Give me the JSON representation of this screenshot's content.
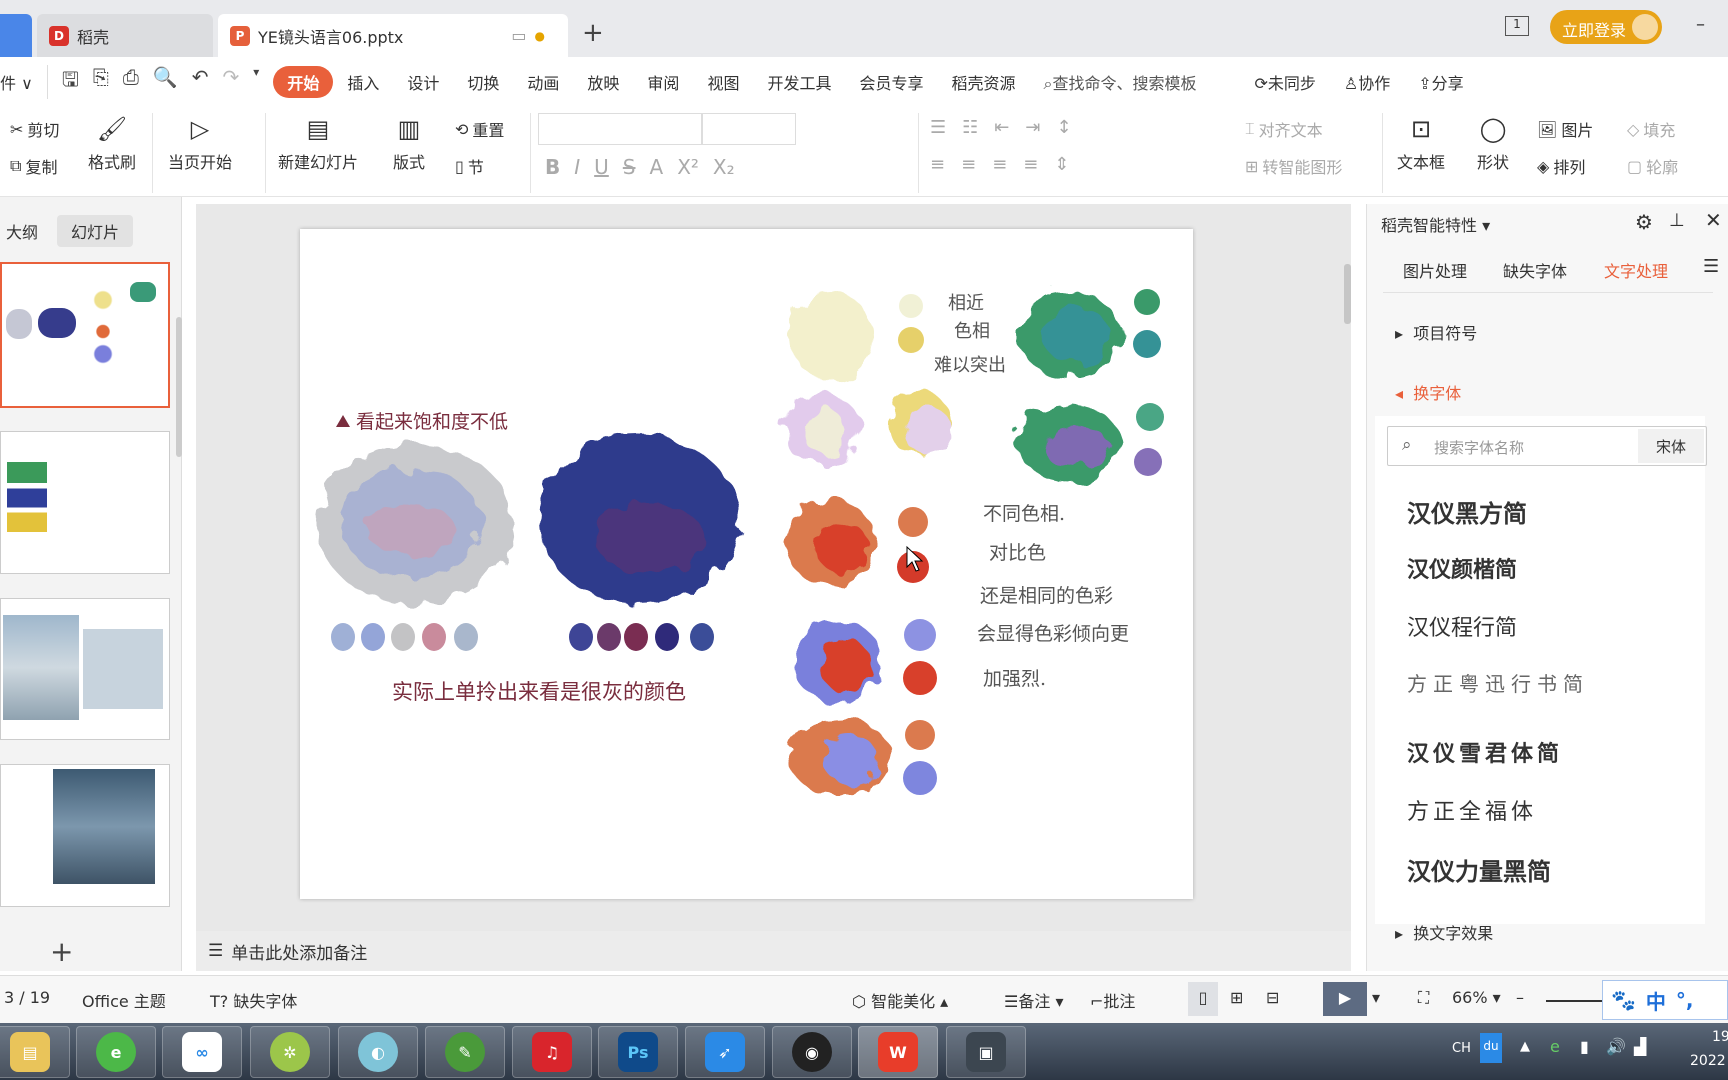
{
  "tabs": {
    "home_tab": "稻壳",
    "doc_tab": "YE镜头语言06.pptx",
    "new_tab": "+",
    "login": "立即登录",
    "page_counter": "1"
  },
  "menu": {
    "file": "件",
    "items": [
      "开始",
      "插入",
      "设计",
      "切换",
      "动画",
      "放映",
      "审阅",
      "视图",
      "开发工具",
      "会员专享",
      "稻壳资源"
    ],
    "search": "查找命令、搜索模板",
    "sync": "未同步",
    "collab": "协作",
    "share": "分享"
  },
  "ribbon": {
    "cut": "剪切",
    "copy": "复制",
    "format_painter": "格式刷",
    "play_from_current": "当页开始",
    "new_slide": "新建幻灯片",
    "layout": "版式",
    "reset": "重置",
    "section": "节",
    "align_text": "对齐文本",
    "smart_graphic": "转智能图形",
    "textbox": "文本框",
    "shape": "形状",
    "picture": "图片",
    "arrange": "排列",
    "fill": "填充",
    "outline": "轮廓"
  },
  "left_pane": {
    "outline_tab": "大纲",
    "slides_tab": "幻灯片",
    "add": "+"
  },
  "slide": {
    "text_saturation": "看起来饱和度不低",
    "text_gray": "实际上单拎出来看是很灰的颜色",
    "text_similar": [
      "相近",
      "色相",
      "难以突出"
    ],
    "text_contrast": [
      "不同色相.",
      "对比色",
      "还是相同的色彩",
      "会显得色彩倾向更",
      "加强烈."
    ],
    "left_swatches": [
      "#9fb0d6",
      "#94a5d8",
      "#c3c3c5",
      "#c98b9c",
      "#a9b7cc"
    ],
    "right_swatches": [
      "#3e4596",
      "#6b3a6a",
      "#7a2d52",
      "#2f2a7a",
      "#3b4d98"
    ]
  },
  "notes": {
    "placeholder": "单击此处添加备注"
  },
  "right_panel": {
    "title": "稻壳智能特性",
    "tabs": [
      "图片处理",
      "缺失字体",
      "文字处理"
    ],
    "sections": {
      "bullets": "项目符号",
      "change_font": "换字体",
      "text_effects": "换文字效果"
    },
    "search_placeholder": "搜索字体名称",
    "current_font": "宋体",
    "fonts": [
      "汉仪黑方简",
      "汉仪颜楷简",
      "汉仪程行简",
      "方正粤迅行书简",
      "汉仪雪君体简",
      "方正全福体",
      "汉仪力量黑简"
    ]
  },
  "status": {
    "slide_counter": "3 / 19",
    "theme": "Office 主题",
    "missing_fonts": "缺失字体",
    "beautify": "智能美化",
    "notes": "备注",
    "comments": "批注",
    "zoom": "66%",
    "ime": "中"
  },
  "taskbar": {
    "tray_lang": "CH",
    "time": "19",
    "date": "2022"
  },
  "colors": {
    "accent": "#e9603b",
    "ink": "#7a2d3e"
  }
}
